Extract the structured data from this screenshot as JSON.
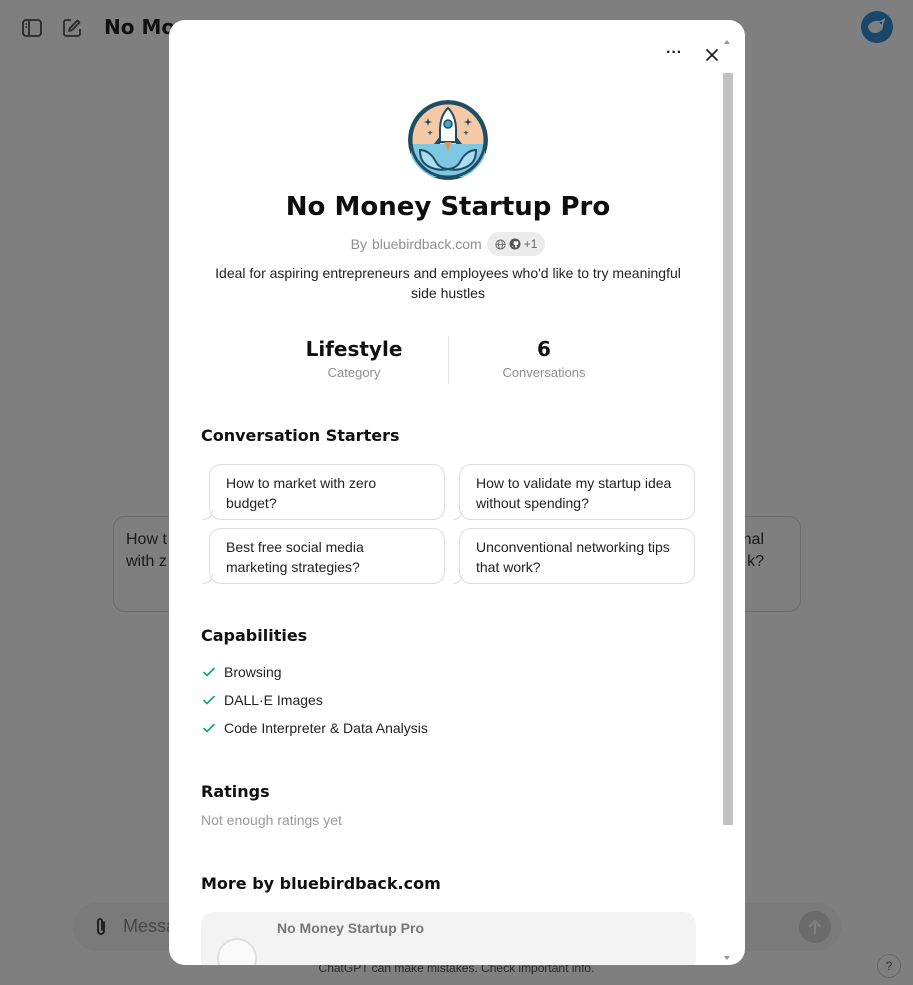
{
  "app": {
    "title": "No Money Startup Pro",
    "title_visible": "No Mo",
    "composer_placeholder": "Message",
    "composer_placeholder_visible": "Messa",
    "footer_note": "ChatGPT can make mistakes. Check important info.",
    "help_label": "?",
    "bg_cards": {
      "left": "How to market with zero budget?",
      "left_visible": "How t\nwith z",
      "right": "Unconventional networking tips that work?",
      "right_visible": "nal\nk?"
    }
  },
  "modal": {
    "more_label": "···",
    "name": "No Money Startup Pro",
    "by_prefix": "By",
    "author": "bluebirdback.com",
    "links_extra": "+1",
    "description": "Ideal for aspiring entrepreneurs and employees who'd like to try meaningful side hustles",
    "stats": [
      {
        "value": "Lifestyle",
        "label": "Category"
      },
      {
        "value": "6",
        "label": "Conversations"
      }
    ],
    "starters_title": "Conversation Starters",
    "starters": [
      "How to market with zero budget?",
      "How to validate my startup idea without spending?",
      "Best free social media marketing strategies?",
      "Unconventional networking tips that work?"
    ],
    "capabilities_title": "Capabilities",
    "capabilities": [
      "Browsing",
      "DALL·E Images",
      "Code Interpreter & Data Analysis"
    ],
    "ratings_title": "Ratings",
    "ratings_text": "Not enough ratings yet",
    "more_by_title": "More by bluebirdback.com",
    "more_by_items": [
      {
        "name": "No Money Startup Pro"
      }
    ]
  },
  "colors": {
    "overlay": "#000000",
    "check": "#10a37f",
    "avatar": "#2e8ed6"
  }
}
